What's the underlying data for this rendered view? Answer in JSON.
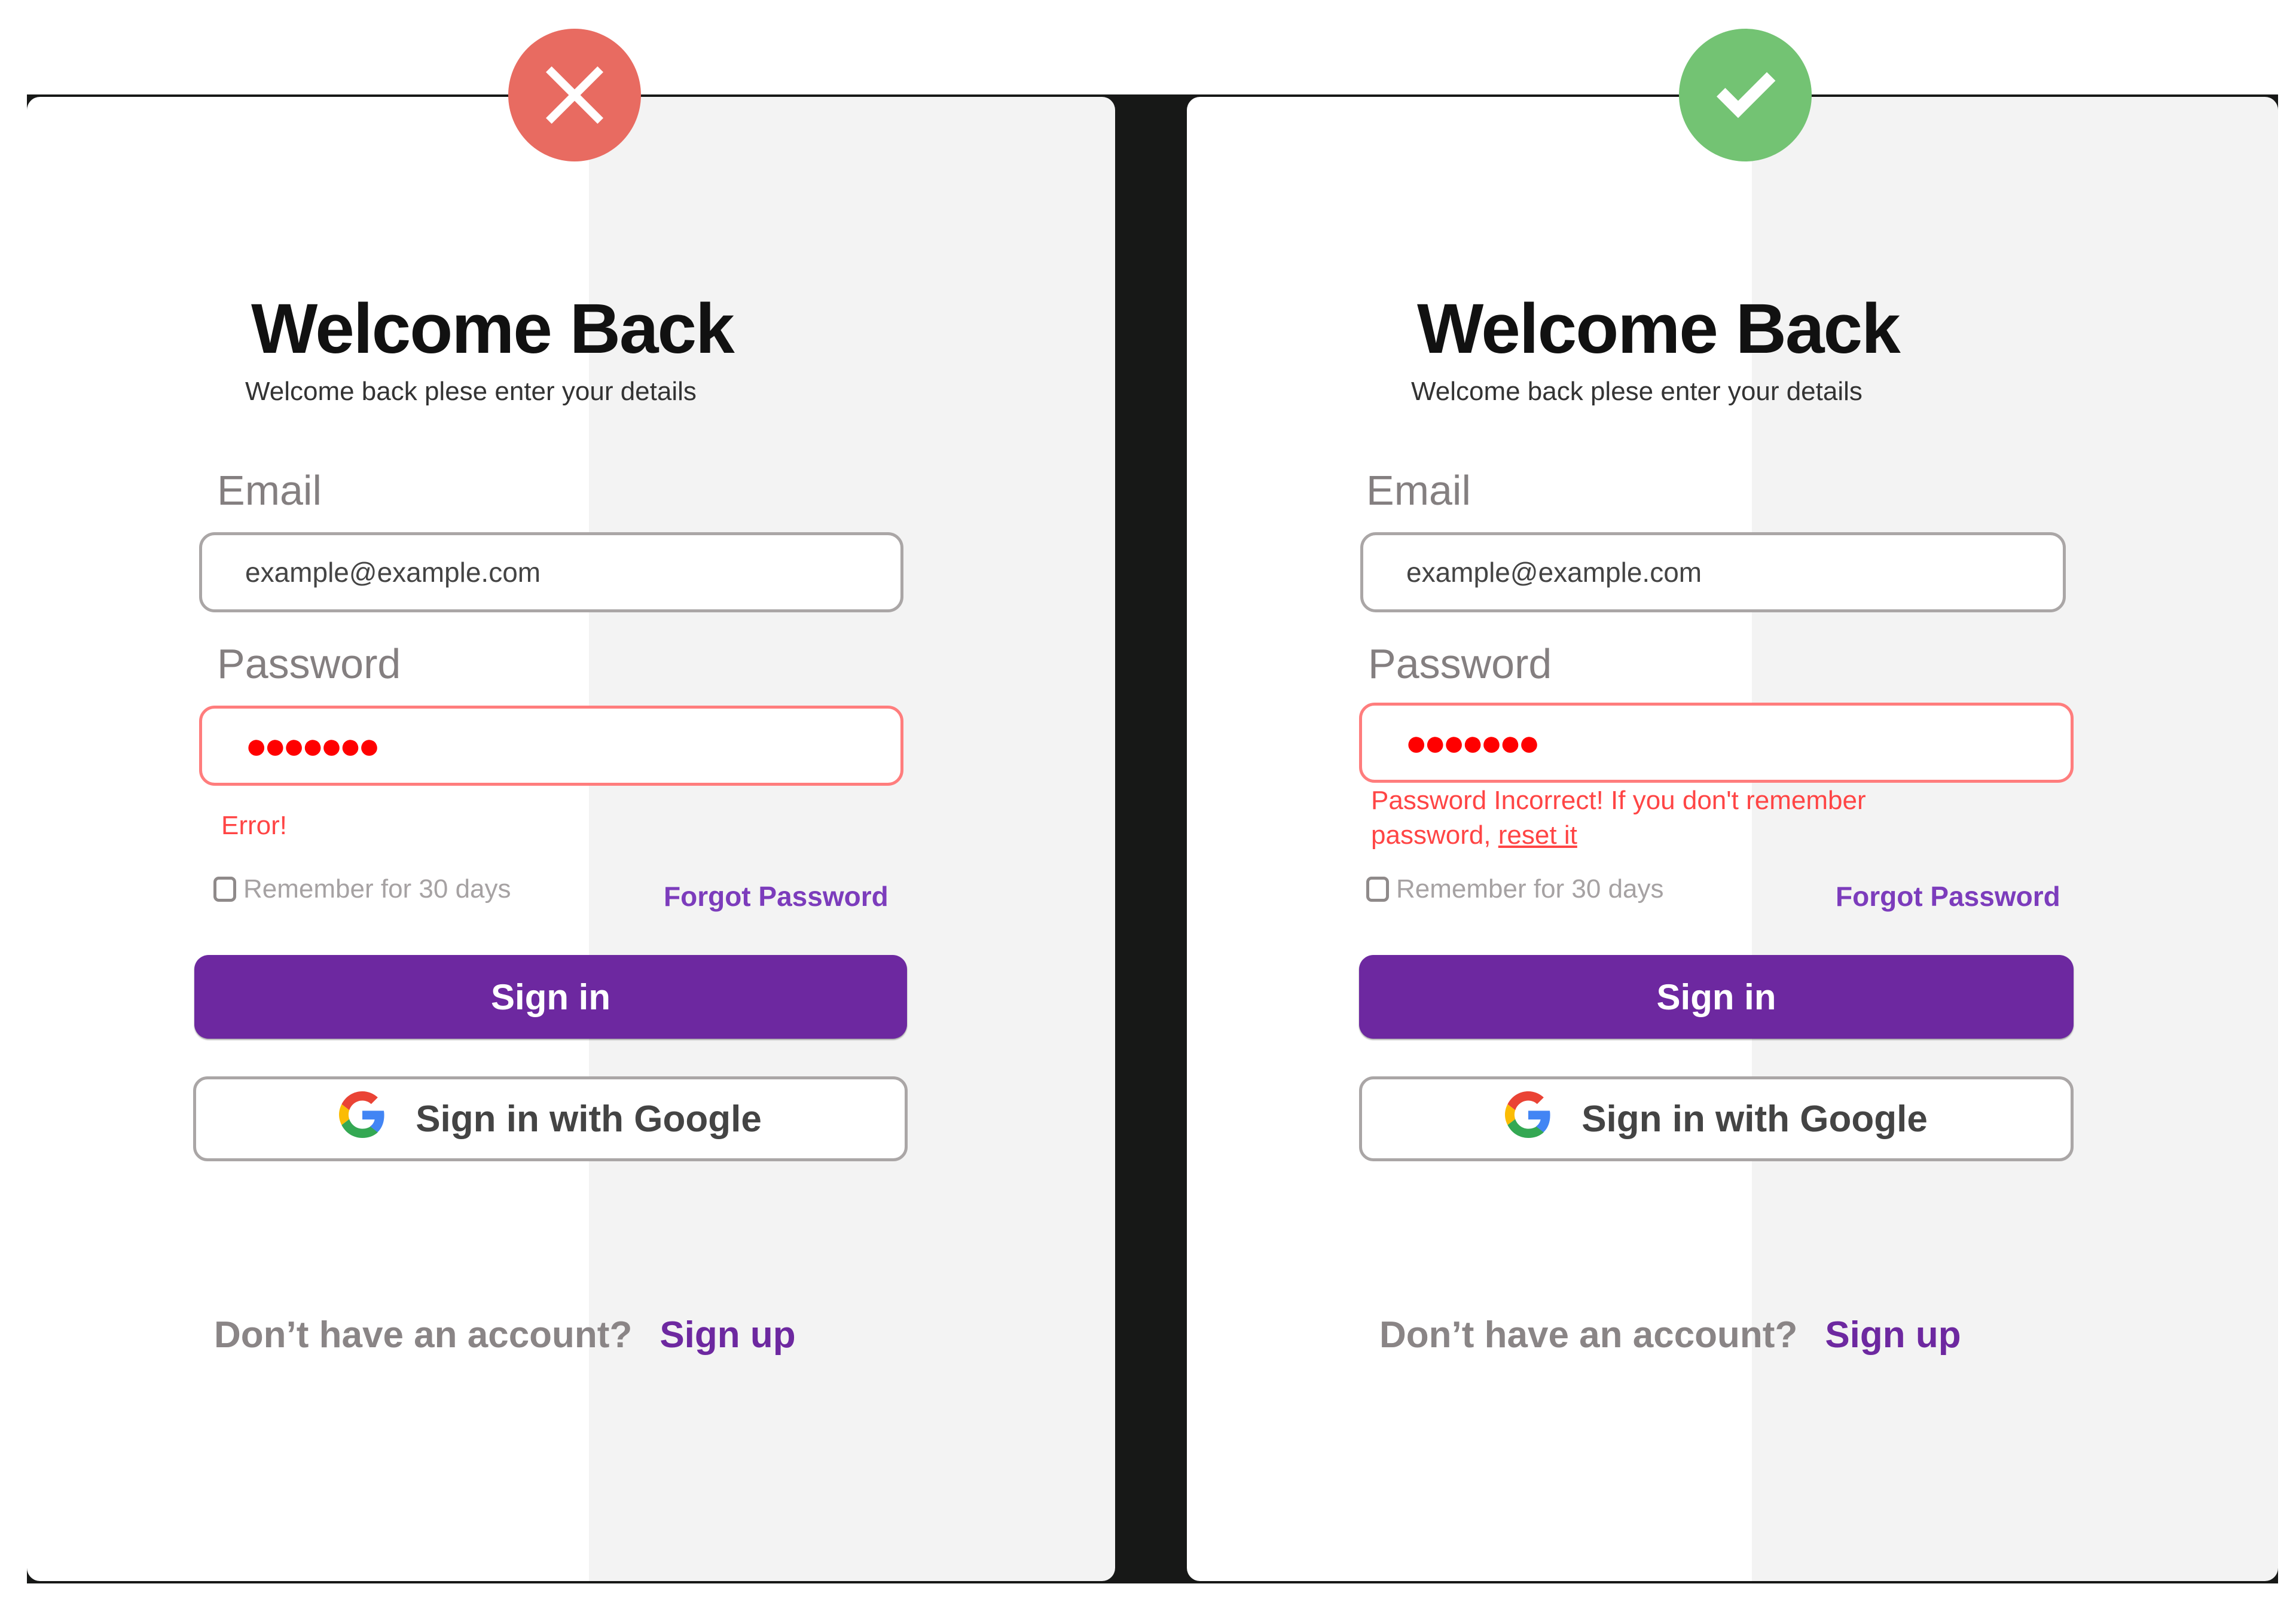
{
  "badges": {
    "bad": {
      "icon": "x-icon",
      "color": "#e86b61"
    },
    "good": {
      "icon": "check-icon",
      "color": "#73c373"
    }
  },
  "colors": {
    "primary": "#6d28a0",
    "link": "#7c3cbc",
    "error": "#ff4545",
    "error_border": "#ff7d7d",
    "divider": "#171817"
  },
  "panels": [
    {
      "variant": "bad",
      "title": "Welcome Back",
      "subtitle": "Welcome back plese enter your details",
      "email_label": "Email",
      "email_value": "example@example.com",
      "password_label": "Password",
      "password_value": "●●●●●●●",
      "error_message": "Error!",
      "remember_label": "Remember for 30 days",
      "remember_checked": false,
      "forgot_label": "Forgot Password",
      "signin_label": "Sign in",
      "google_label": "Sign in with Google",
      "no_account": "Don’t have an account?",
      "signup_label": "Sign up"
    },
    {
      "variant": "good",
      "title": "Welcome Back",
      "subtitle": "Welcome back plese enter your details",
      "email_label": "Email",
      "email_value": "example@example.com",
      "password_label": "Password",
      "password_value": "●●●●●●●",
      "error_message_line1": "Password  Incorrect! If you don't remember",
      "error_message_line2_prefix": "password,",
      "error_message_link": "reset it",
      "remember_label": "Remember for 30 days",
      "remember_checked": false,
      "forgot_label": "Forgot Password",
      "signin_label": "Sign in",
      "google_label": "Sign in with Google",
      "no_account": "Don’t have an account?",
      "signup_label": "Sign up"
    }
  ]
}
